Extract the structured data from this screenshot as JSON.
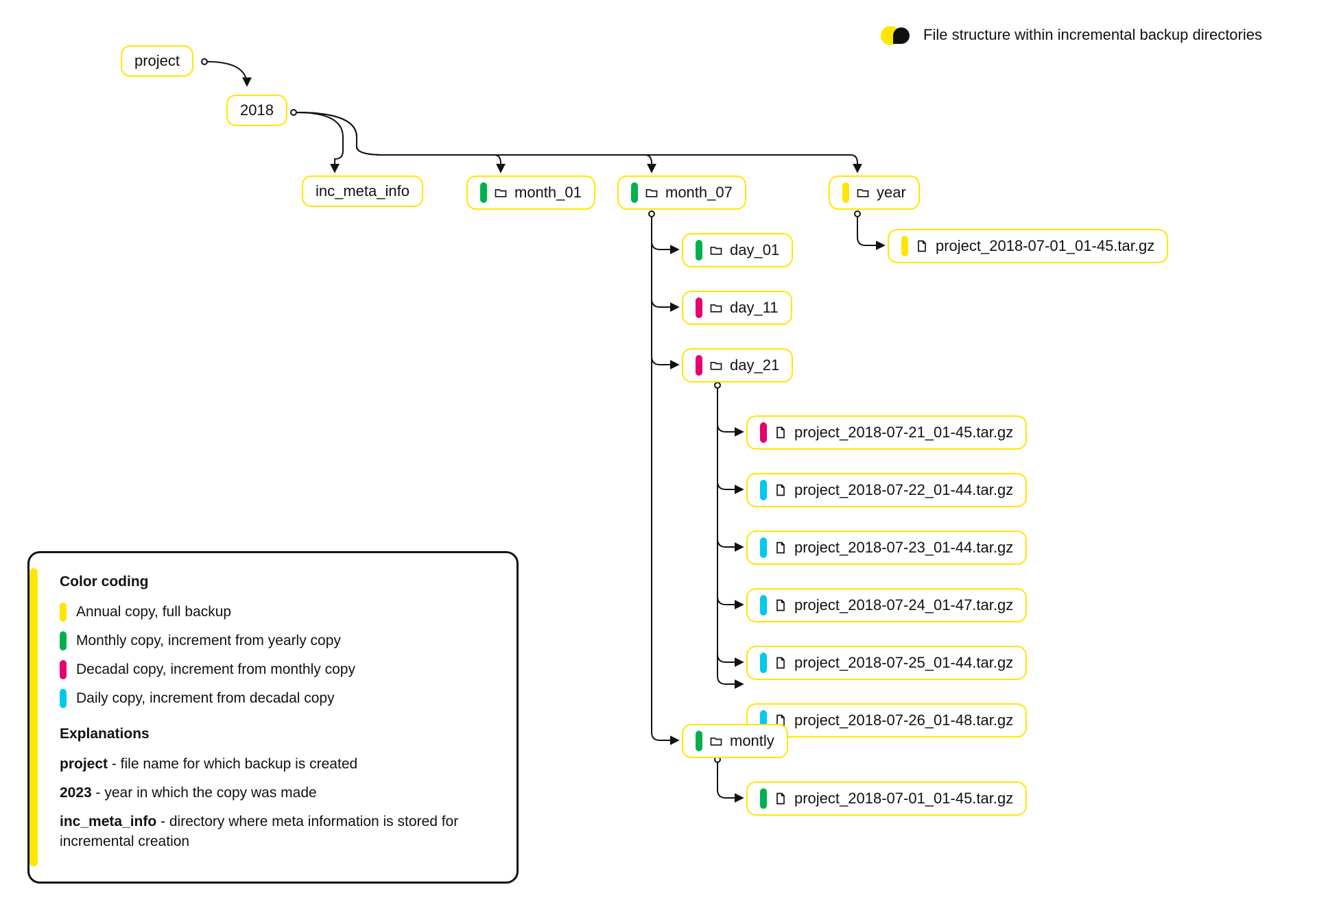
{
  "header": {
    "title": "File structure within incremental backup directories"
  },
  "colors": {
    "yellow": "#ffe600",
    "green": "#00b050",
    "pink": "#e5006d",
    "cyan": "#00c8f0"
  },
  "tree": {
    "root": {
      "label": "project"
    },
    "year": {
      "label": "2018"
    },
    "inc_meta": {
      "label": "inc_meta_info"
    },
    "month_01": {
      "label": "month_01"
    },
    "month_07": {
      "label": "month_07"
    },
    "year_dir": {
      "label": "year"
    },
    "year_file": {
      "label": "project_2018-07-01_01-45.tar.gz"
    },
    "day_01": {
      "label": "day_01"
    },
    "day_11": {
      "label": "day_11"
    },
    "day_21": {
      "label": "day_21"
    },
    "day21_files": [
      "project_2018-07-21_01-45.tar.gz",
      "project_2018-07-22_01-44.tar.gz",
      "project_2018-07-23_01-44.tar.gz",
      "project_2018-07-24_01-47.tar.gz",
      "project_2018-07-25_01-44.tar.gz",
      "project_2018-07-26_01-48.tar.gz"
    ],
    "monthly_dir": {
      "label": "montly"
    },
    "monthly_file": {
      "label": "project_2018-07-01_01-45.tar.gz"
    }
  },
  "legend": {
    "color_heading": "Color coding",
    "items": [
      {
        "color": "yellow",
        "text": "Annual copy, full backup"
      },
      {
        "color": "green",
        "text": "Monthly copy, increment from yearly copy"
      },
      {
        "color": "pink",
        "text": "Decadal copy, increment from monthly copy"
      },
      {
        "color": "cyan",
        "text": "Daily copy, increment from decadal copy"
      }
    ],
    "expl_heading": "Explanations",
    "expl": {
      "project_b": "project",
      "project_t": " - file name for which backup is created",
      "year_b": "2023",
      "year_t": " - year in which the copy was made",
      "meta_b": "inc_meta_info",
      "meta_t": " - directory where meta information is stored for incremental creation"
    }
  }
}
